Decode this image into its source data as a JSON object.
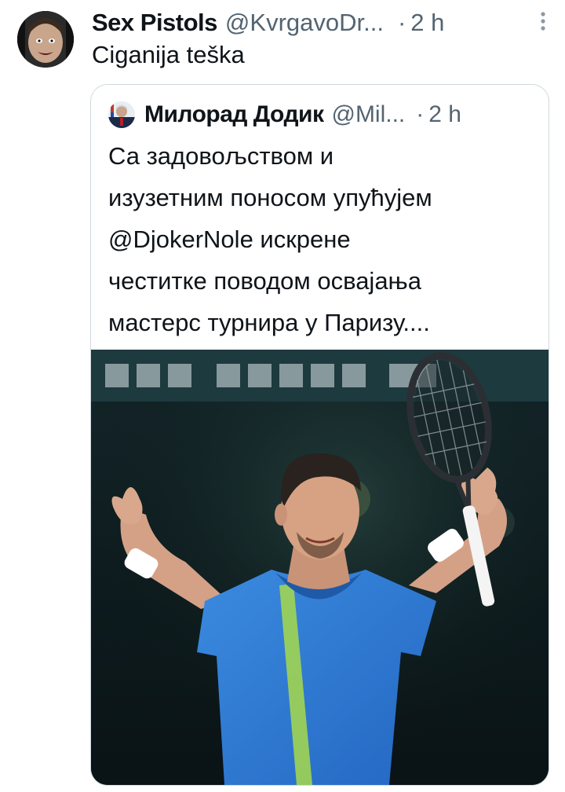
{
  "tweet": {
    "author_name": "Sex Pistols",
    "author_handle": "@KvrgavoDr...",
    "separator": "·",
    "time": "2 h",
    "more_icon": "vertical-ellipsis-icon",
    "text": "Ciganija teška"
  },
  "quoted": {
    "author_name": "Милорад Додик",
    "author_handle": "@Mil...",
    "separator": "·",
    "time": "2 h",
    "text_lines": [
      "Са задовољством и",
      "изузетним поносом упућујем",
      "@DjokerNole искрене",
      "честитке поводом освајања",
      "мастерс турнира у Паризу...."
    ]
  },
  "colors": {
    "text_primary": "#0f1419",
    "text_secondary": "#536471",
    "border": "#cfd9de",
    "shirt_blue": "#2f7fd6"
  }
}
